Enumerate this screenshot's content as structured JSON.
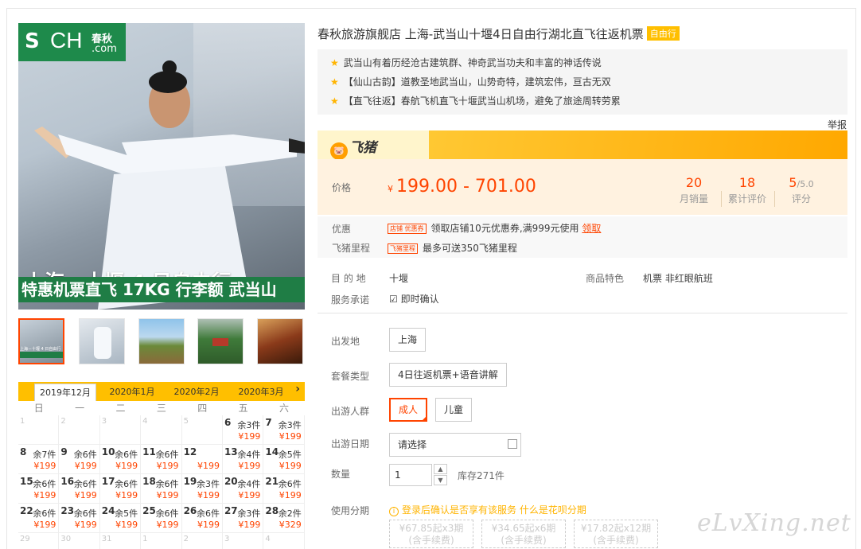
{
  "brand": {
    "mark": "S",
    "ch": "CH",
    "cn": "春秋",
    "com": ".com"
  },
  "hero": {
    "caption1": "上海－十堰 4 日自由行",
    "caption2": "特惠机票直飞 17KG 行李额 武当山"
  },
  "thumb_captions": {
    "t1": "上海－十堰 4 日自由行"
  },
  "title": "春秋旅游旗舰店 上海-武当山十堰4日自由行湖北直飞往返机票",
  "title_tag": "自由行",
  "highlights": [
    "武当山有着历经沧古建筑群、神奇武当功夫和丰富的神话传说",
    "【仙山古韵】道教圣地武当山，山势奇特，建筑宏伟，亘古无双",
    "【直飞往返】春航飞机直飞十堰武当山机场，避免了旅途周转劳累"
  ],
  "report": "举报",
  "feizhu": {
    "logo": "飞猪",
    "pig": "🐷"
  },
  "price": {
    "label": "价格",
    "currency": "¥",
    "value": "199.00 - 701.00"
  },
  "stats": [
    {
      "num": "20",
      "label": "月销量"
    },
    {
      "num": "18",
      "label": "累计评价"
    },
    {
      "num": "5",
      "suffix": "/5.0",
      "label": "评分"
    }
  ],
  "promo": {
    "label": "优惠",
    "tag": "店铺 优惠券",
    "text": "领取店铺10元优惠券,满999元使用",
    "link": "领取",
    "miles_label": "飞猪里程",
    "miles_tag": "飞猪里程",
    "miles_text": "最多可送350飞猪里程"
  },
  "info": {
    "dest_label": "目 的 地",
    "dest": "十堰",
    "feature_label": "商品特色",
    "feature": "机票  非红眼航班",
    "service_label": "服务承诺",
    "service": "即时确认",
    "service_icon": "☑"
  },
  "form": {
    "depart_label": "出发地",
    "depart": "上海",
    "package_label": "套餐类型",
    "package": "4日往返机票+语音讲解",
    "crowd_label": "出游人群",
    "crowd_adult": "成人",
    "crowd_child": "儿童",
    "date_label": "出游日期",
    "date_placeholder": "请选择",
    "qty_label": "数量",
    "qty": "1",
    "stock": "库存271件",
    "installment_label": "使用分期",
    "installment_note": "登录后确认是否享有该服务",
    "installment_link": "什么是花呗分期",
    "installments": [
      {
        "amount": "¥67.85起x3期",
        "note": "(含手续费)"
      },
      {
        "amount": "¥34.65起x6期",
        "note": "(含手续费)"
      },
      {
        "amount": "¥17.82起x12期",
        "note": "(含手续费)"
      }
    ]
  },
  "calendar": {
    "tabs": [
      "2019年12月",
      "2020年1月",
      "2020年2月",
      "2020年3月"
    ],
    "next": "›",
    "weekdays": [
      "日",
      "一",
      "二",
      "三",
      "四",
      "五",
      "六"
    ],
    "days": [
      {
        "d": "1",
        "dim": true
      },
      {
        "d": "2",
        "dim": true
      },
      {
        "d": "3",
        "dim": true
      },
      {
        "d": "4",
        "dim": true
      },
      {
        "d": "5",
        "dim": true
      },
      {
        "d": "6",
        "s": "余3件",
        "p": "¥199"
      },
      {
        "d": "7",
        "s": "余3件",
        "p": "¥199"
      },
      {
        "d": "8",
        "s": "余7件",
        "p": "¥199"
      },
      {
        "d": "9",
        "s": "余6件",
        "p": "¥199"
      },
      {
        "d": "10",
        "s": "余6件",
        "p": "¥199"
      },
      {
        "d": "11",
        "s": "余6件",
        "p": "¥199"
      },
      {
        "d": "12",
        "s": "",
        "p": "¥199"
      },
      {
        "d": "13",
        "s": "余4件",
        "p": "¥199"
      },
      {
        "d": "14",
        "s": "余5件",
        "p": "¥199"
      },
      {
        "d": "15",
        "s": "余6件",
        "p": "¥199"
      },
      {
        "d": "16",
        "s": "余6件",
        "p": "¥199"
      },
      {
        "d": "17",
        "s": "余6件",
        "p": "¥199"
      },
      {
        "d": "18",
        "s": "余6件",
        "p": "¥199"
      },
      {
        "d": "19",
        "s": "余3件",
        "p": "¥199"
      },
      {
        "d": "20",
        "s": "余4件",
        "p": "¥199"
      },
      {
        "d": "21",
        "s": "余6件",
        "p": "¥199"
      },
      {
        "d": "22",
        "s": "余6件",
        "p": "¥199"
      },
      {
        "d": "23",
        "s": "余6件",
        "p": "¥199"
      },
      {
        "d": "24",
        "s": "余5件",
        "p": "¥199"
      },
      {
        "d": "25",
        "s": "余6件",
        "p": "¥199"
      },
      {
        "d": "26",
        "s": "余6件",
        "p": "¥199"
      },
      {
        "d": "27",
        "s": "余3件",
        "p": "¥199"
      },
      {
        "d": "28",
        "s": "余2件",
        "p": "¥329"
      },
      {
        "d": "29",
        "dim": true
      },
      {
        "d": "30",
        "dim": true
      },
      {
        "d": "31",
        "dim": true
      },
      {
        "d": "1",
        "dim": true
      },
      {
        "d": "2",
        "dim": true
      },
      {
        "d": "3",
        "dim": true
      },
      {
        "d": "4",
        "dim": true
      }
    ]
  },
  "watermark": "eLvXing.net",
  "colors": {
    "accent": "#ff4400",
    "brand_green": "#1e8a4b",
    "feizhu_yellow": "#ffbf00"
  }
}
